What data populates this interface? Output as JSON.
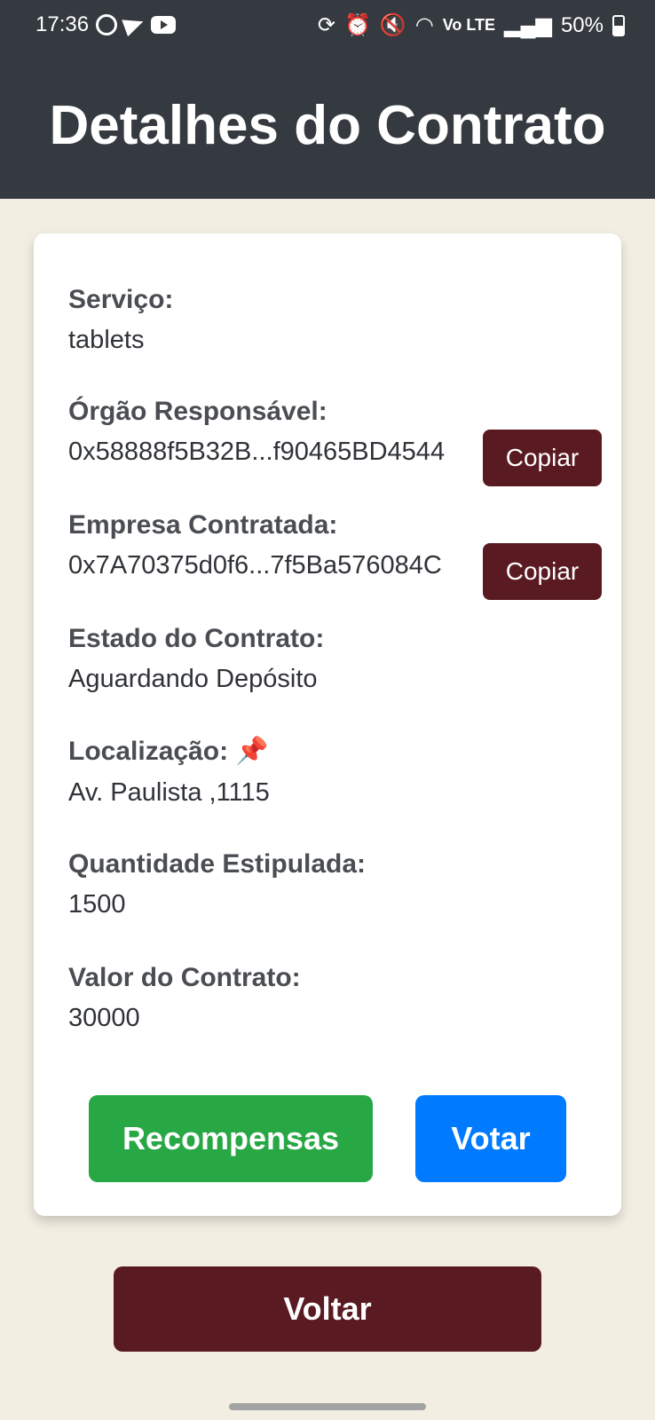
{
  "status_bar": {
    "time": "17:36",
    "battery": "50%",
    "left_icons": [
      "whatsapp-icon",
      "telegram-icon",
      "youtube-icon"
    ],
    "right_icons": [
      "sync-icon",
      "alarm-icon",
      "mute-icon",
      "wifi-icon",
      "volte-icon",
      "signal-icon",
      "battery-icon"
    ],
    "volte": "Vo LTE"
  },
  "header": {
    "title": "Detalhes do Contrato"
  },
  "contract": {
    "service_label": "Serviço:",
    "service_value": "tablets",
    "organ_label": "Órgão Responsável:",
    "organ_value": "0x58888f5B32B...f90465BD4544",
    "company_label": "Empresa Contratada:",
    "company_value": "0x7A70375d0f6...7f5Ba576084C",
    "copy_label": "Copiar",
    "state_label": "Estado do Contrato:",
    "state_value": "Aguardando Depósito",
    "location_label": "Localização:",
    "location_icon": "📌",
    "location_value": "Av. Paulista ,1115",
    "quantity_label": "Quantidade Estipulada:",
    "quantity_value": "1500",
    "value_label": "Valor do Contrato:",
    "value_value": "30000"
  },
  "actions": {
    "rewards_label": "Recompensas",
    "vote_label": "Votar",
    "back_label": "Voltar"
  },
  "colors": {
    "header_bg": "#343a40",
    "page_bg": "#f2eee2",
    "maroon": "#5a1a22",
    "green": "#28a745",
    "blue": "#007bff"
  }
}
